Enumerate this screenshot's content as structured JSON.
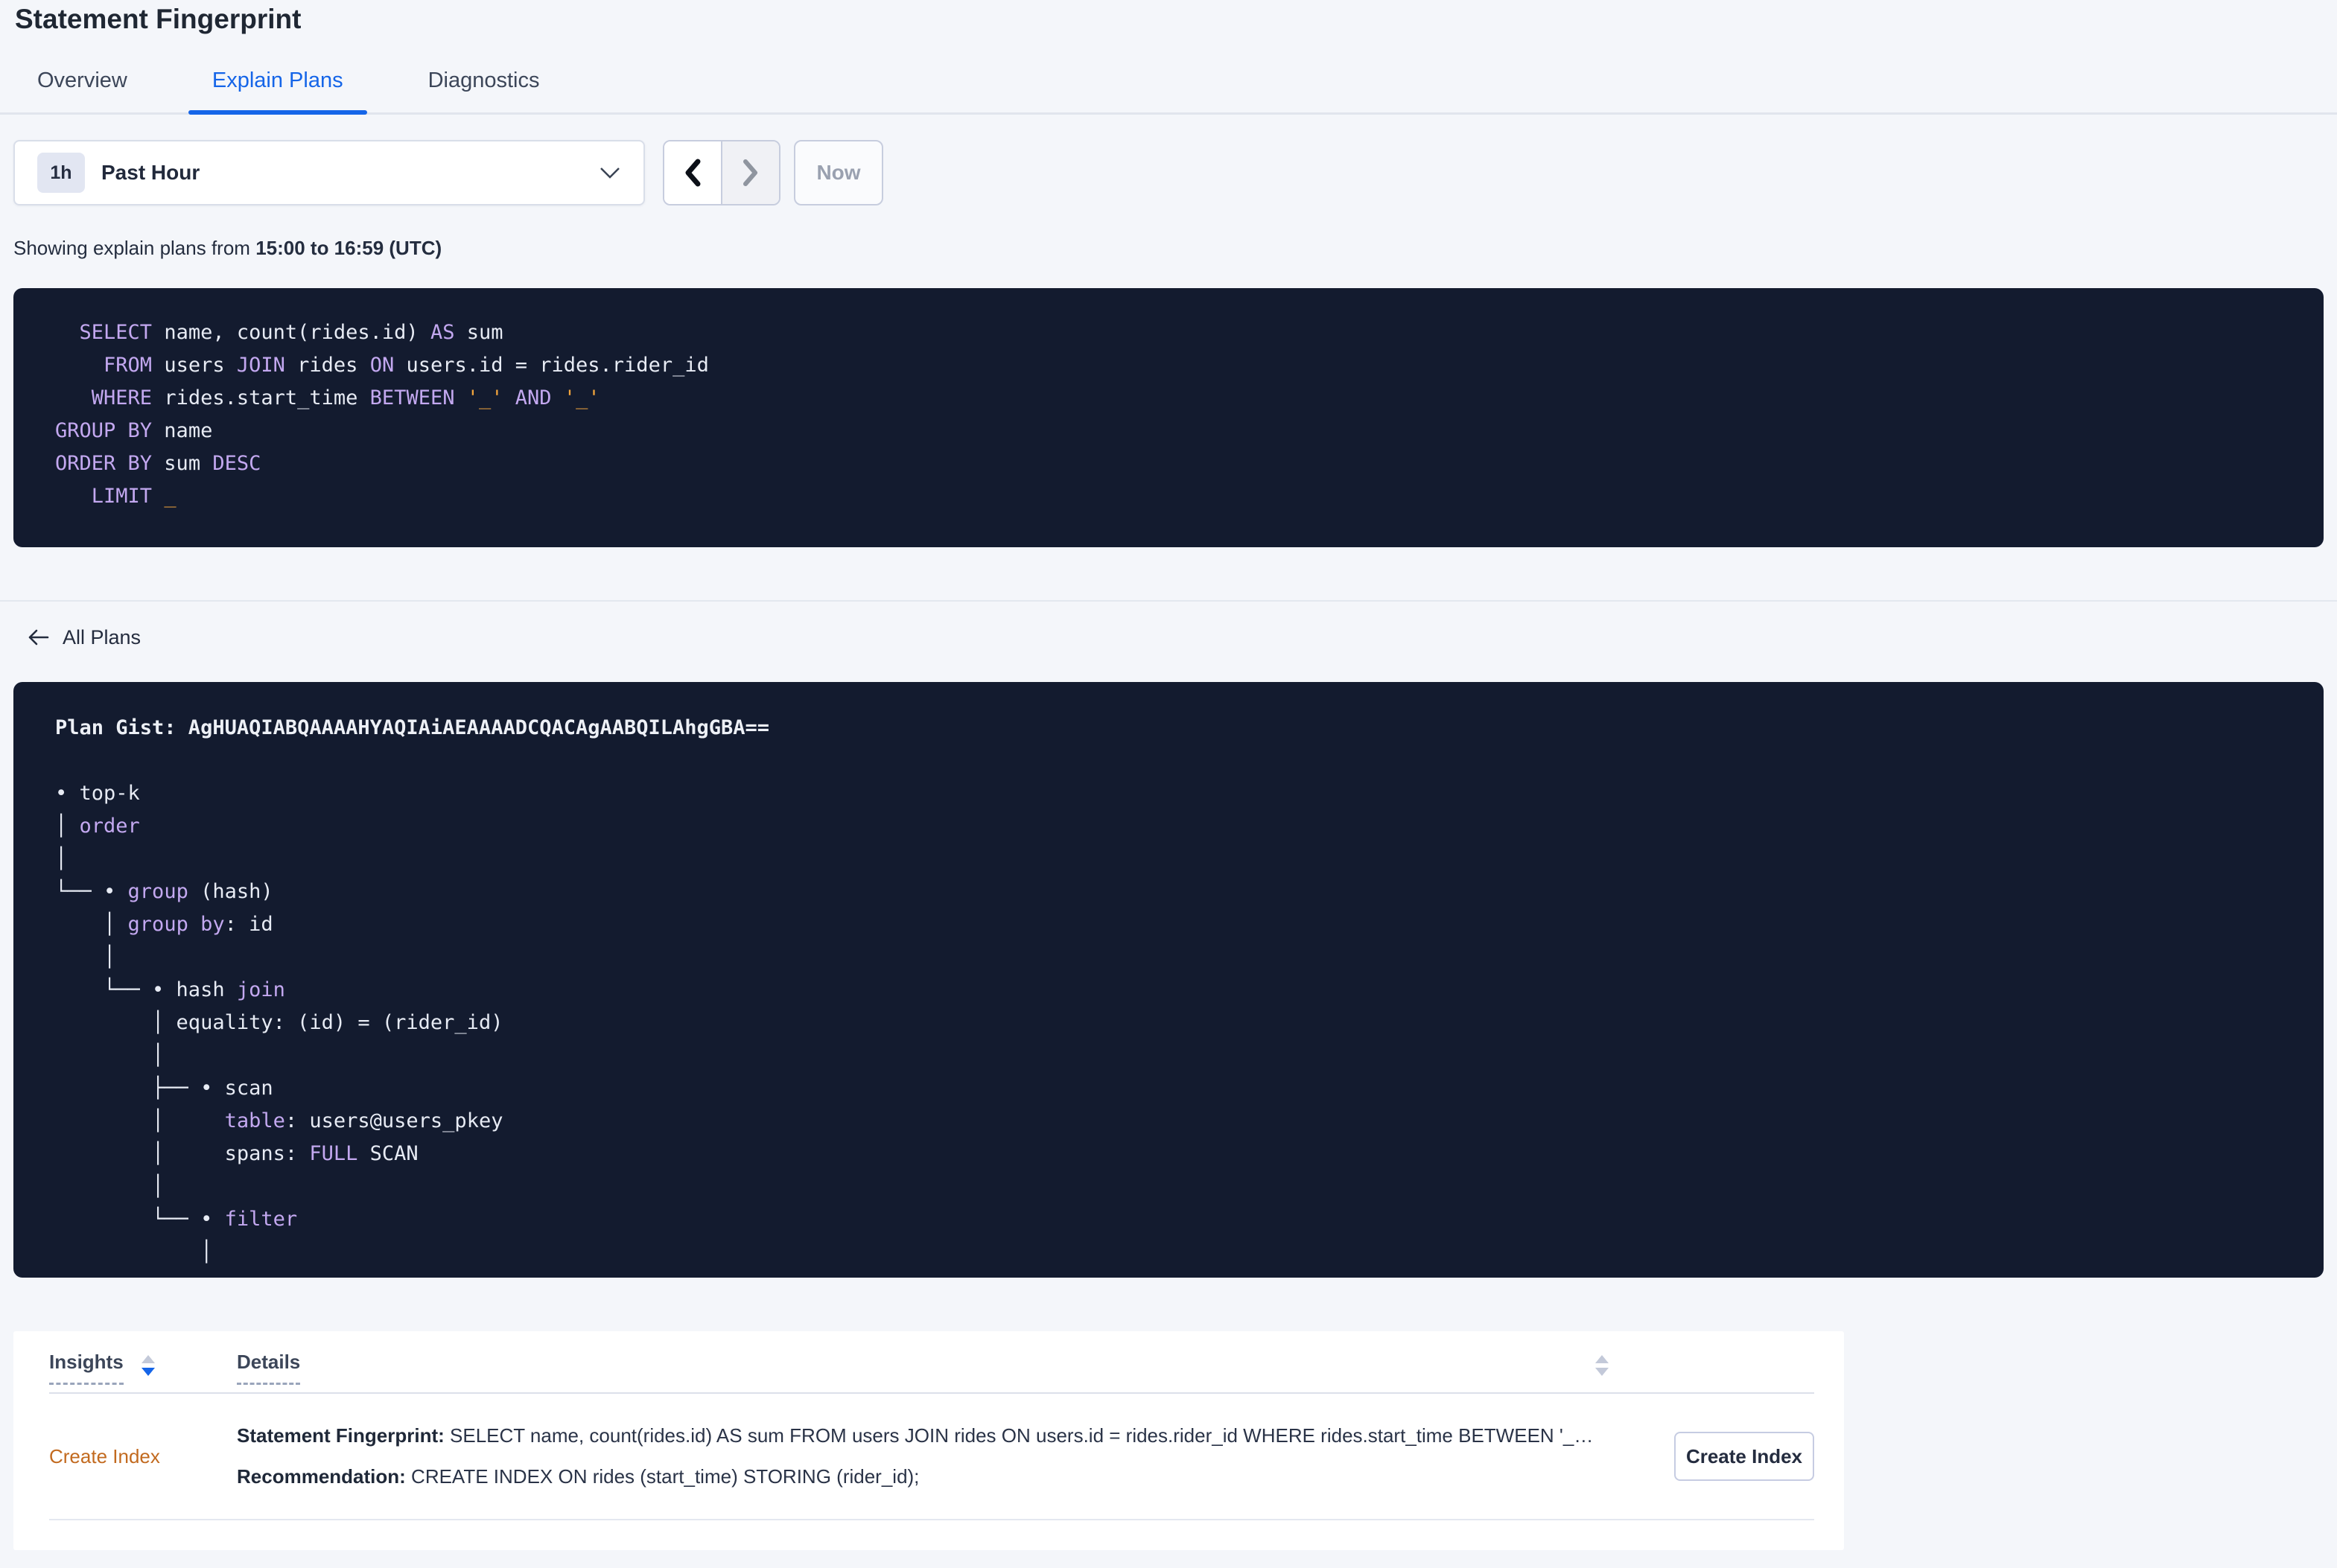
{
  "colors": {
    "accent_blue": "#1565E8",
    "keyword_purple": "#C3A8F0",
    "placeholder_orange": "#F2A43C",
    "insight_orange": "#C26A1F",
    "code_background": "#131B2F"
  },
  "header": {
    "title": "Statement Fingerprint"
  },
  "tabs": [
    {
      "label": "Overview"
    },
    {
      "label": "Explain Plans"
    },
    {
      "label": "Diagnostics"
    }
  ],
  "time_picker": {
    "badge": "1h",
    "label": "Past Hour"
  },
  "nav": {
    "now_label": "Now"
  },
  "caption": {
    "prefix": "Showing explain plans from ",
    "range": "15:00 to 16:59 (UTC)"
  },
  "sql_box": {
    "lines": [
      [
        [
          "t",
          "  "
        ],
        [
          "k",
          "SELECT"
        ],
        [
          "t",
          " name, count(rides.id) "
        ],
        [
          "k",
          "AS"
        ],
        [
          "t",
          " sum"
        ]
      ],
      [
        [
          "t",
          "    "
        ],
        [
          "k",
          "FROM"
        ],
        [
          "t",
          " users "
        ],
        [
          "k",
          "JOIN"
        ],
        [
          "t",
          " rides "
        ],
        [
          "k",
          "ON"
        ],
        [
          "t",
          " users.id = rides.rider_id"
        ]
      ],
      [
        [
          "t",
          "   "
        ],
        [
          "k",
          "WHERE"
        ],
        [
          "t",
          " rides.start_time "
        ],
        [
          "k",
          "BETWEEN"
        ],
        [
          "t",
          " "
        ],
        [
          "p",
          "'_'"
        ],
        [
          "t",
          " "
        ],
        [
          "k",
          "AND"
        ],
        [
          "t",
          " "
        ],
        [
          "p",
          "'_'"
        ]
      ],
      [
        [
          "k",
          "GROUP BY"
        ],
        [
          "t",
          " name"
        ]
      ],
      [
        [
          "k",
          "ORDER BY"
        ],
        [
          "t",
          " sum "
        ],
        [
          "k",
          "DESC"
        ]
      ],
      [
        [
          "t",
          "   "
        ],
        [
          "k",
          "LIMIT"
        ],
        [
          "t",
          " "
        ],
        [
          "p",
          "_"
        ]
      ]
    ]
  },
  "plans_nav": {
    "back_label": "All Plans"
  },
  "plan_box": {
    "lines": [
      [
        [
          "b",
          "Plan Gist: AgHUAQIABQAAAAHYAQIAiAEAAAADCQACAgAABQILAhgGBA=="
        ]
      ],
      [
        [
          "t",
          ""
        ]
      ],
      [
        [
          "t",
          "• top-k"
        ]
      ],
      [
        [
          "t",
          "│ "
        ],
        [
          "k",
          "order"
        ]
      ],
      [
        [
          "t",
          "│"
        ]
      ],
      [
        [
          "t",
          "└── • "
        ],
        [
          "k",
          "group"
        ],
        [
          "t",
          " (hash)"
        ]
      ],
      [
        [
          "t",
          "    │ "
        ],
        [
          "k",
          "group by"
        ],
        [
          "t",
          ": id"
        ]
      ],
      [
        [
          "t",
          "    │"
        ]
      ],
      [
        [
          "t",
          "    └── • hash "
        ],
        [
          "k",
          "join"
        ]
      ],
      [
        [
          "t",
          "        │ equality: (id) = (rider_id)"
        ]
      ],
      [
        [
          "t",
          "        │"
        ]
      ],
      [
        [
          "t",
          "        ├── • scan"
        ]
      ],
      [
        [
          "t",
          "        │     "
        ],
        [
          "k",
          "table"
        ],
        [
          "t",
          ": users@users_pkey"
        ]
      ],
      [
        [
          "t",
          "        │     spans: "
        ],
        [
          "k",
          "FULL"
        ],
        [
          "t",
          " SCAN"
        ]
      ],
      [
        [
          "t",
          "        │"
        ]
      ],
      [
        [
          "t",
          "        └── • "
        ],
        [
          "k",
          "filter"
        ]
      ],
      [
        [
          "t",
          "            │"
        ]
      ]
    ]
  },
  "insights_table": {
    "columns": {
      "insights": "Insights",
      "details": "Details"
    },
    "rows": [
      {
        "insight": "Create Index",
        "fingerprint_label": "Statement Fingerprint:",
        "fingerprint_text": " SELECT name, count(rides.id) AS sum FROM users JOIN rides ON users.id = rides.rider_id WHERE rides.start_time BETWEEN '_…",
        "recommendation_label": "Recommendation:",
        "recommendation_text": " CREATE INDEX ON rides (start_time) STORING (rider_id);",
        "action_label": "Create Index"
      }
    ]
  }
}
